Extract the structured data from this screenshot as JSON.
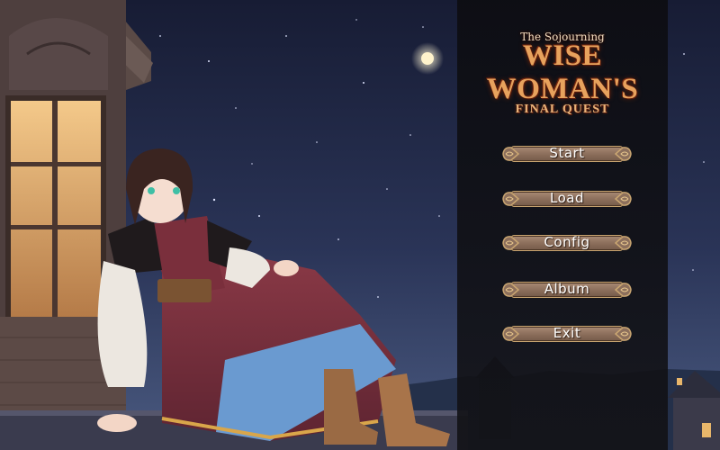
{
  "title": {
    "subtitle": "The Sojourning",
    "main": "WISE WOMAN'S",
    "tail": "FINAL QUEST"
  },
  "menu": [
    {
      "id": "start",
      "label": "Start"
    },
    {
      "id": "load",
      "label": "Load"
    },
    {
      "id": "config",
      "label": "Config"
    },
    {
      "id": "album",
      "label": "Album"
    },
    {
      "id": "exit",
      "label": "Exit"
    }
  ],
  "colors": {
    "panel": "#121216",
    "title_orange": "#e7a25d",
    "button_fill": "#8c6f5c",
    "button_border": "#c9a571"
  }
}
